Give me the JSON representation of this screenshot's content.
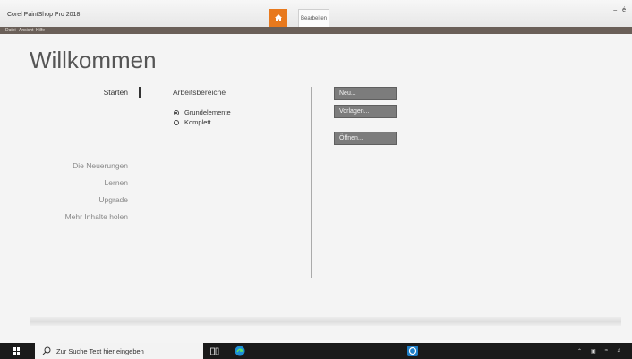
{
  "app": {
    "title": "Corel PaintShop Pro 2018",
    "tab_edit": "Bearbeiten",
    "window_controls": "– é"
  },
  "menu": [
    "Datei",
    "Ansicht",
    "Hilfe"
  ],
  "welcome": {
    "title": "Willkommen"
  },
  "nav": {
    "start": "Starten",
    "news": "Die Neuerungen",
    "learn": "Lernen",
    "upgrade": "Upgrade",
    "more": "Mehr Inhalte holen"
  },
  "workspaces": {
    "title": "Arbeitsbereiche",
    "options": [
      {
        "label": "Grundelemente",
        "selected": true
      },
      {
        "label": "Komplett",
        "selected": false
      }
    ]
  },
  "actions": {
    "new": "Neu...",
    "templates": "Vorlagen...",
    "open": "Öffnen..."
  },
  "taskbar": {
    "search_placeholder": "Zur Suche Text hier eingeben"
  },
  "colors": {
    "accent": "#e8791d",
    "menubar": "#6a5f58",
    "button": "#7c7c7c",
    "taskbar": "#1a1a1a"
  },
  "icons": [
    "home-icon",
    "windows-logo-icon",
    "search-icon",
    "task-view-icon",
    "edge-icon",
    "paintshop-icon",
    "chevron-up-icon",
    "network-icon",
    "wifi-icon",
    "volume-icon"
  ]
}
